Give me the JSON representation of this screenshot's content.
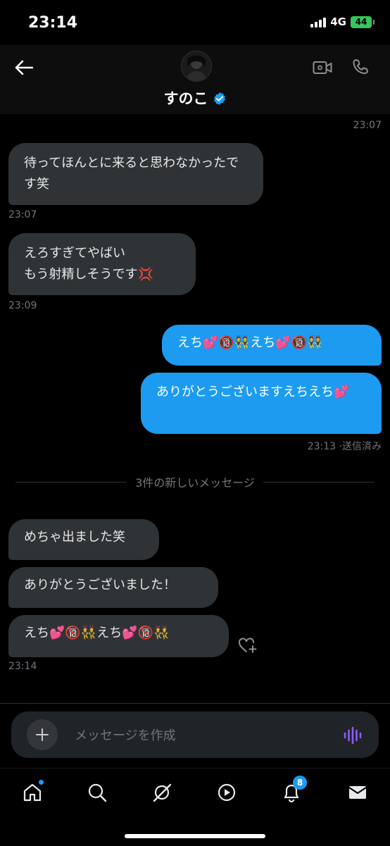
{
  "status": {
    "time": "23:14",
    "network": "4G",
    "battery": "44"
  },
  "header": {
    "name": "すのこ"
  },
  "messages": [
    {
      "dir": "ts",
      "time": "23:07"
    },
    {
      "dir": "in",
      "text": "待ってほんとに来ると思わなかったです笑",
      "time": "23:07"
    },
    {
      "dir": "in",
      "text": "えろすぎてやばい\nもう射精しそうです💢",
      "time": "23:09"
    },
    {
      "dir": "out",
      "text": "えち💕🔞👯えち💕🔞👯"
    },
    {
      "dir": "out",
      "text": "ありがとうございますえちえち💕",
      "time": "23:13",
      "status": "送信済み"
    },
    {
      "dir": "in",
      "text": "めちゃ出ました笑"
    },
    {
      "dir": "in",
      "text": "ありがとうございました！"
    },
    {
      "dir": "in",
      "text": "えち💕🔞👯えち💕🔞👯",
      "time": "23:14"
    }
  ],
  "new_messages_label": "3件の新しいメッセージ",
  "composer": {
    "placeholder": "メッセージを作成"
  },
  "tabs": {
    "notifications_badge": "8"
  },
  "colors": {
    "accent": "#1d9bf0",
    "incoming_bubble": "#2f3336",
    "background": "#000000"
  }
}
